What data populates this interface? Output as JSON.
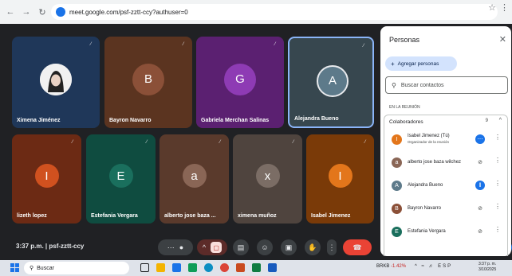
{
  "browser": {
    "url": "meet.google.com/psf-zztt-ccy?authuser=0"
  },
  "tiles": [
    {
      "name": "Ximena Jiménez",
      "initial": "",
      "bg": "#1f3759",
      "avatar_bg": "#ffffff",
      "has_photo": true
    },
    {
      "name": "Bayron Navarro",
      "initial": "B",
      "bg": "#5b3420",
      "avatar_bg": "#8b5038"
    },
    {
      "name": "Gabriela Merchan Salinas",
      "initial": "G",
      "bg": "#5b2071",
      "avatar_bg": "#8e3bb4"
    },
    {
      "name": "Alejandra Bueno",
      "initial": "A",
      "bg": "#37474f",
      "avatar_bg": "#5d7a8a"
    },
    {
      "name": "lizeth lopez",
      "initial": "I",
      "bg": "#6c2a14",
      "avatar_bg": "#d0511f"
    },
    {
      "name": "Estefania Vergara",
      "initial": "E",
      "bg": "#0f4c40",
      "avatar_bg": "#1a6f5d"
    },
    {
      "name": "alberto jose baza ...",
      "initial": "a",
      "bg": "#5a3a2c",
      "avatar_bg": "#8a6656"
    },
    {
      "name": "ximena muñoz",
      "initial": "x",
      "bg": "#4f443e",
      "avatar_bg": "#7b6d65"
    },
    {
      "name": "Isabel Jimenez",
      "initial": "I",
      "bg": "#7a3a08",
      "avatar_bg": "#e3761b"
    }
  ],
  "meeting": {
    "time_code": "3:37 p.m.  |  psf-zztt-ccy"
  },
  "panel": {
    "title": "Personas",
    "add_label": "Agregar personas",
    "search_placeholder": "Buscar contactos",
    "section_label": "EN LA REUNIÓN",
    "group_label": "Colaboradores",
    "group_count": "9",
    "people": [
      {
        "name": "Isabel Jimenez (Tú)",
        "role": "Organizador de la reunión",
        "initial": "I",
        "color": "#e3761b",
        "status": "more"
      },
      {
        "name": "alberto jose baza wilchez",
        "initial": "a",
        "color": "#8a6656",
        "status": "muted"
      },
      {
        "name": "Alejandra Bueno",
        "initial": "A",
        "color": "#5d7a8a",
        "status": "speaking"
      },
      {
        "name": "Bayron Navarro",
        "initial": "B",
        "color": "#8b5038",
        "status": "muted"
      },
      {
        "name": "Estefania Vergara",
        "initial": "E",
        "color": "#1a6f5d",
        "status": "muted"
      }
    ]
  },
  "taskbar": {
    "search_label": "Buscar",
    "ticker_symbol": "BRKB",
    "ticker_change": "-1.42%",
    "lang": "ESP",
    "time": "3:37 p. m.",
    "date": "3/10/2025"
  },
  "colors": {
    "end_call": "#ea4335",
    "accent": "#1a73e8",
    "active_border": "#8ab4f8"
  }
}
